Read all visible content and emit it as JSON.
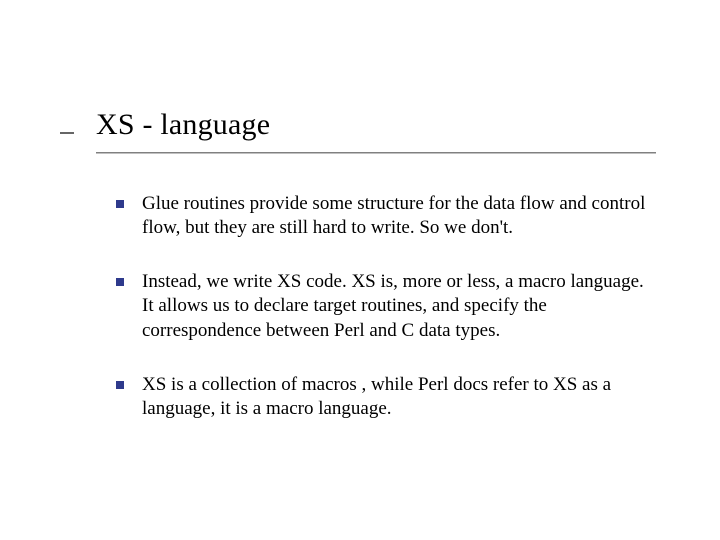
{
  "slide": {
    "title": "XS - language",
    "bullets": [
      {
        "text": "Glue routines provide some structure for the data flow and control flow, but they are still hard to write.  So we don't."
      },
      {
        "text": "Instead, we write XS code. XS is, more or less, a macro language. It allows us to declare target routines, and specify the correspondence between Perl and C data types."
      },
      {
        "text": "XS is a collection of macros , while Perl docs refer to XS as a language, it is a macro language."
      }
    ]
  },
  "colors": {
    "bullet": "#2e3a8c"
  }
}
